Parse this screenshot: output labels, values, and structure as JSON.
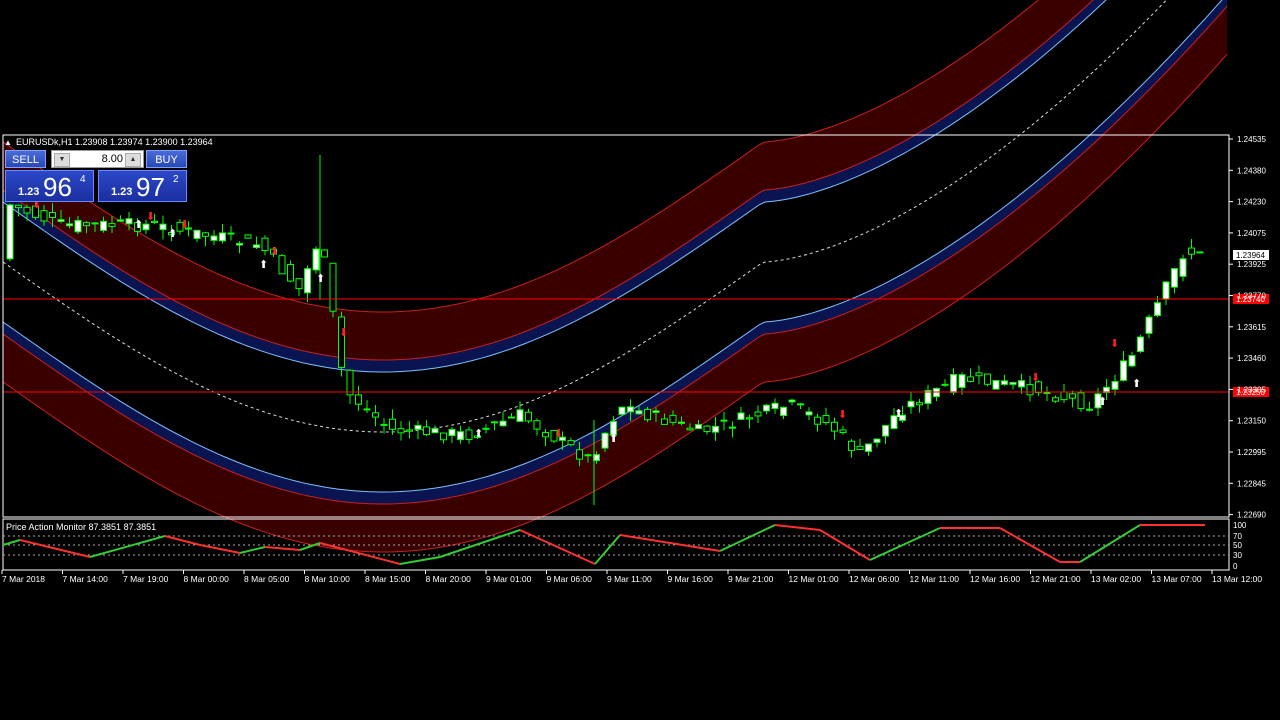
{
  "chart": {
    "symbol_line": "EURUSDk,H1  1.23908 1.23974 1.23900 1.23964",
    "price_ticks": [
      "1.24535",
      "1.24380",
      "1.24230",
      "1.24075",
      "1.23925",
      "1.23770",
      "1.23615",
      "1.23460",
      "1.23305",
      "1.23150",
      "1.22995",
      "1.22845",
      "1.22690"
    ],
    "current_price": "1.23964",
    "level_upper": "1.23740",
    "level_lower": "1.23250",
    "colors": {
      "band_outer": "#3a0000",
      "band_edge": "#c82020",
      "band_inner": "#0a1450",
      "band_line": "#7fc0ff",
      "bull": "#ffffff",
      "bear": "#00ff00",
      "level": "#ff0000"
    }
  },
  "trade_panel": {
    "sell_label": "SELL",
    "buy_label": "BUY",
    "lot_value": "8.00",
    "bid_prefix": "1.23",
    "bid_big": "96",
    "bid_frac": "4",
    "ask_prefix": "1.23",
    "ask_big": "97",
    "ask_frac": "2"
  },
  "indicator": {
    "title": "Price Action Monitor 87.3851 87.3851",
    "levels": [
      "100",
      "70",
      "50",
      "30",
      "0"
    ]
  },
  "time_axis": [
    "7 Mar 2018",
    "7 Mar 14:00",
    "7 Mar 19:00",
    "8 Mar 00:00",
    "8 Mar 05:00",
    "8 Mar 10:00",
    "8 Mar 15:00",
    "8 Mar 20:00",
    "9 Mar 01:00",
    "9 Mar 06:00",
    "9 Mar 11:00",
    "9 Mar 16:00",
    "9 Mar 21:00",
    "12 Mar 01:00",
    "12 Mar 06:00",
    "12 Mar 11:00",
    "12 Mar 16:00",
    "12 Mar 21:00",
    "13 Mar 02:00",
    "13 Mar 07:00",
    "13 Mar 12:00"
  ]
}
